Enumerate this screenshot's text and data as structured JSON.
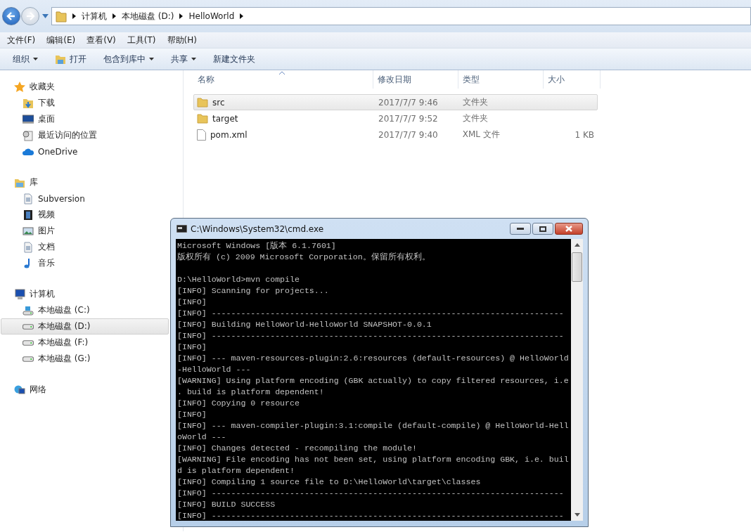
{
  "address_bar": {
    "crumbs": [
      "计算机",
      "本地磁盘 (D:)",
      "HelloWorld"
    ]
  },
  "menu_bar": [
    "文件(F)",
    "编辑(E)",
    "查看(V)",
    "工具(T)",
    "帮助(H)"
  ],
  "toolbar": [
    {
      "label": "组织",
      "kind": "dropdown"
    },
    {
      "label": "打开",
      "kind": "open"
    },
    {
      "label": "包含到库中",
      "kind": "dropdown"
    },
    {
      "label": "共享",
      "kind": "dropdown"
    },
    {
      "label": "新建文件夹",
      "kind": "plain"
    }
  ],
  "sidebar": {
    "groups": [
      {
        "label": "收藏夹",
        "kind": "star",
        "children": [
          {
            "label": "下载",
            "kind": "download",
            "selected": false
          },
          {
            "label": "桌面",
            "kind": "desktop",
            "selected": false
          },
          {
            "label": "最近访问的位置",
            "kind": "recent",
            "selected": false
          },
          {
            "label": "OneDrive",
            "kind": "cloud",
            "selected": false
          }
        ]
      },
      {
        "label": "库",
        "kind": "library",
        "children": [
          {
            "label": "Subversion",
            "kind": "doc",
            "selected": false
          },
          {
            "label": "视频",
            "kind": "video",
            "selected": false
          },
          {
            "label": "图片",
            "kind": "picture",
            "selected": false
          },
          {
            "label": "文档",
            "kind": "doc",
            "selected": false
          },
          {
            "label": "音乐",
            "kind": "music",
            "selected": false
          }
        ]
      },
      {
        "label": "计算机",
        "kind": "computer",
        "children": [
          {
            "label": "本地磁盘 (C:)",
            "kind": "system-drive",
            "selected": false
          },
          {
            "label": "本地磁盘 (D:)",
            "kind": "drive",
            "selected": true
          },
          {
            "label": "本地磁盘 (F:)",
            "kind": "drive",
            "selected": false
          },
          {
            "label": "本地磁盘 (G:)",
            "kind": "drive",
            "selected": false
          }
        ]
      },
      {
        "label": "网络",
        "kind": "network"
      }
    ]
  },
  "file_list": {
    "columns": [
      "名称",
      "修改日期",
      "类型",
      "大小"
    ],
    "rows": [
      {
        "name": "src",
        "kind": "folder",
        "modified": "2017/7/7 9:46",
        "type": "文件夹",
        "size": "",
        "selected": true
      },
      {
        "name": "target",
        "kind": "folder",
        "modified": "2017/7/7 9:52",
        "type": "文件夹",
        "size": "",
        "selected": false
      },
      {
        "name": "pom.xml",
        "kind": "file",
        "modified": "2017/7/7 9:40",
        "type": "XML 文件",
        "size": "1 KB",
        "selected": false
      }
    ]
  },
  "console_window": {
    "title": "C:\\Windows\\System32\\cmd.exe",
    "blocks": [
      [
        "Microsoft Windows [版本 6.1.7601]",
        "版权所有 (c) 2009 Microsoft Corporation。保留所有权利。"
      ],
      [
        "D:\\HelloWorld>mvn compile",
        "[INFO] Scanning for projects...",
        "[INFO]",
        "[INFO] ------------------------------------------------------------------------",
        "[INFO] Building HelloWorld-HelloWorld SNAPSHOT-0.0.1",
        "[INFO] ------------------------------------------------------------------------",
        "[INFO]",
        "[INFO] --- maven-resources-plugin:2.6:resources (default-resources) @ HelloWorld",
        "-HelloWorld ---",
        "[WARNING] Using platform encoding (GBK actually) to copy filtered resources, i.e",
        ". build is platform dependent!",
        "[INFO] Copying 0 resource",
        "[INFO]",
        "[INFO] --- maven-compiler-plugin:3.1:compile (default-compile) @ HelloWorld-Hell",
        "oWorld ---",
        "[INFO] Changes detected - recompiling the module!",
        "[WARNING] File encoding has not been set, using platform encoding GBK, i.e. buil",
        "d is platform dependent!",
        "[INFO] Compiling 1 source file to D:\\HelloWorld\\target\\classes",
        "[INFO] ------------------------------------------------------------------------",
        "[INFO] BUILD SUCCESS",
        "[INFO] ------------------------------------------------------------------------"
      ]
    ]
  }
}
